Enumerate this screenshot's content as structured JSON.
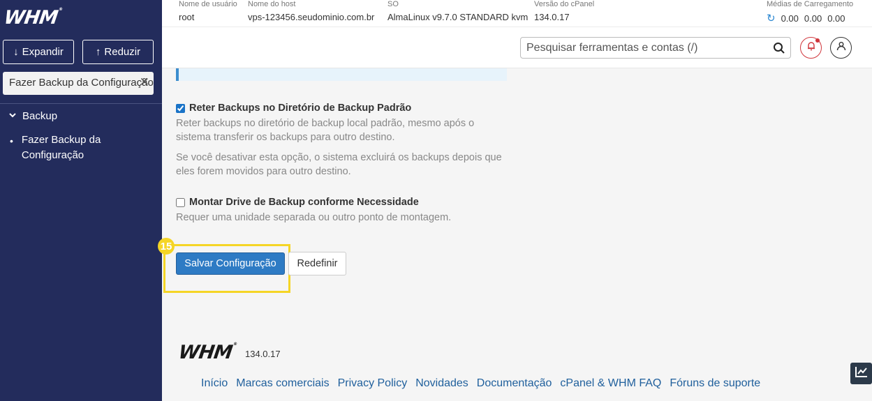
{
  "sidebar": {
    "logo": "WHM",
    "expand_label": "Expandir",
    "reduce_label": "Reduzir",
    "search_value": "Fazer Backup da Configuração",
    "group_label": "Backup",
    "item_label_line1": "Fazer Backup da",
    "item_label_line2": "Configuração"
  },
  "header": {
    "columns": [
      {
        "label": "Nome de usuário",
        "value": "root"
      },
      {
        "label": "Nome do host",
        "value": "vps-123456.seudominio.com.br"
      },
      {
        "label": "SO",
        "value": "AlmaLinux v9.7.0 STANDARD kvm"
      },
      {
        "label": "Versão do cPanel",
        "value": "134.0.17"
      },
      {
        "label": "Médias de Carregamento",
        "values": [
          "0.00",
          "0.00",
          "0.00"
        ]
      }
    ],
    "search_placeholder": "Pesquisar ferramentas e contas (/)"
  },
  "main": {
    "option1": {
      "label": "Reter Backups no Diretório de Backup Padrão",
      "checked": true,
      "desc1": "Reter backups no diretório de backup local padrão, mesmo após o sistema transferir os backups para outro destino.",
      "desc2": "Se você desativar esta opção, o sistema excluirá os backups depois que eles forem movidos para outro destino."
    },
    "option2": {
      "label": "Montar Drive de Backup conforme Necessidade",
      "checked": false,
      "desc": "Requer uma unidade separada ou outro ponto de montagem."
    },
    "step_badge": "15",
    "save_label": "Salvar Configuração",
    "reset_label": "Redefinir"
  },
  "footer": {
    "logo": "WHM",
    "version": "134.0.17",
    "links": [
      "Início",
      "Marcas comerciais",
      "Privacy Policy",
      "Novidades",
      "Documentação",
      "cPanel & WHM FAQ",
      "Fóruns de suporte"
    ]
  },
  "colors": {
    "sidebar_bg": "#232c5c",
    "primary": "#2e7bc4",
    "highlight": "#f5d526",
    "bell": "#d0363c",
    "link": "#1f5f9c"
  }
}
